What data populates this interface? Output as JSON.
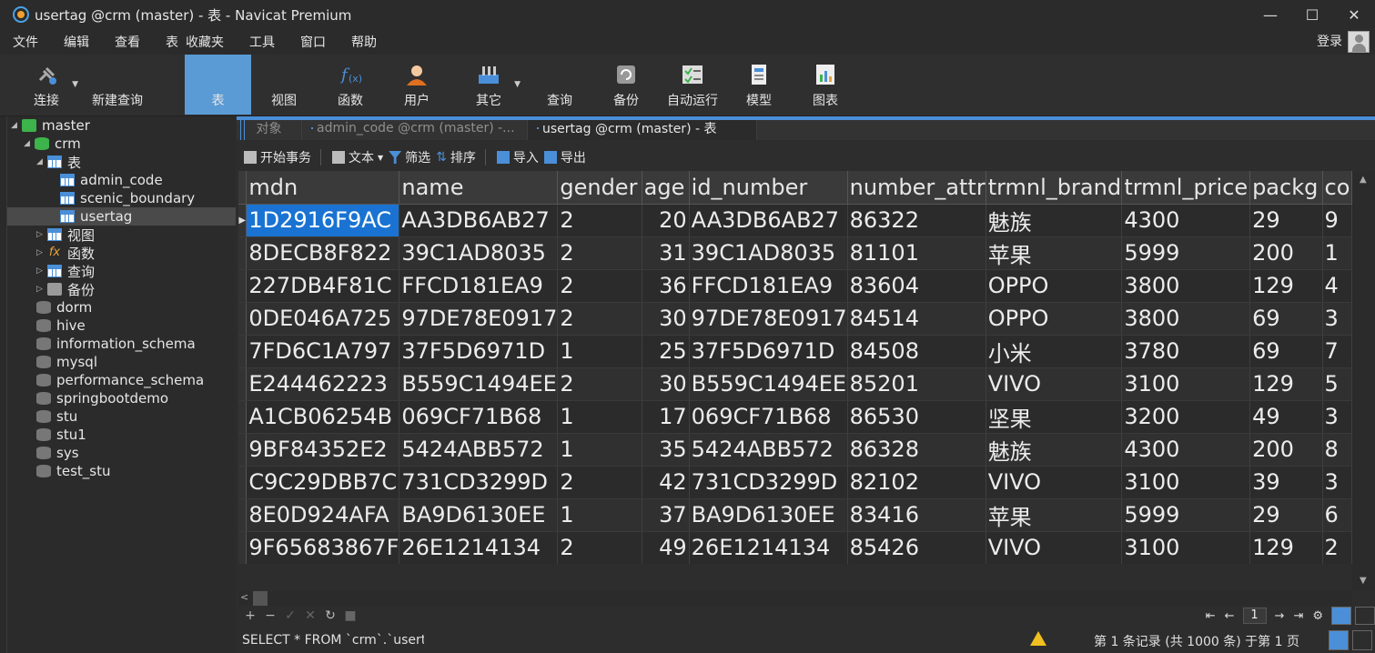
{
  "window": {
    "title": "usertag @crm (master) - 表 - Navicat Premium",
    "controls": [
      "—",
      "☐",
      "✕"
    ]
  },
  "menu": {
    "items": [
      "文件",
      "编辑",
      "查看",
      "表",
      "收藏夹",
      "工具",
      "窗口",
      "帮助"
    ],
    "login": "登录"
  },
  "toolbar": {
    "connect": "连接",
    "new_query": "新建查询",
    "table": "表",
    "view": "视图",
    "function": "函数",
    "user": "用户",
    "other": "其它",
    "query": "查询",
    "backup": "备份",
    "auto_run": "自动运行",
    "model": "模型",
    "chart": "图表"
  },
  "tree": {
    "connection": "master",
    "database": "crm",
    "tables_folder": "表",
    "tables": [
      "admin_code",
      "scenic_boundary",
      "usertag"
    ],
    "views": "视图",
    "functions": "函数",
    "queries": "查询",
    "backups": "备份",
    "other_dbs": [
      "dorm",
      "hive",
      "information_schema",
      "mysql",
      "performance_schema",
      "springbootdemo",
      "stu",
      "stu1",
      "sys",
      "test_stu"
    ]
  },
  "tabs": [
    {
      "label": "对象"
    },
    {
      "label": "admin_code @crm (master) -..."
    },
    {
      "label": "usertag @crm (master) - 表"
    }
  ],
  "subtoolbar": {
    "begin_transaction": "开始事务",
    "text": "文本",
    "filter": "筛选",
    "sort": "排序",
    "import": "导入",
    "export": "导出"
  },
  "grid": {
    "columns": [
      "mdn",
      "name",
      "gender",
      "age",
      "id_number",
      "number_attr",
      "trmnl_brand",
      "trmnl_price",
      "packg",
      "co"
    ],
    "rows": [
      [
        "1D2916F9AC",
        "AA3DB6AB27",
        "2",
        "20",
        "AA3DB6AB27",
        "86322",
        "魅族",
        "4300",
        "29",
        "9"
      ],
      [
        "8DECB8F822",
        "39C1AD8035",
        "2",
        "31",
        "39C1AD8035",
        "81101",
        "苹果",
        "5999",
        "200",
        "1"
      ],
      [
        "227DB4F81C",
        "FFCD181EA9",
        "2",
        "36",
        "FFCD181EA9",
        "83604",
        "OPPO",
        "3800",
        "129",
        "4"
      ],
      [
        "0DE046A725",
        "97DE78E0917",
        "2",
        "30",
        "97DE78E0917",
        "84514",
        "OPPO",
        "3800",
        "69",
        "3"
      ],
      [
        "7FD6C1A797",
        "37F5D6971D",
        "1",
        "25",
        "37F5D6971D",
        "84508",
        "小米",
        "3780",
        "69",
        "7"
      ],
      [
        "E244462223",
        "B559C1494EE",
        "2",
        "30",
        "B559C1494EE",
        "85201",
        "VIVO",
        "3100",
        "129",
        "5"
      ],
      [
        "A1CB06254B",
        "069CF71B68",
        "1",
        "17",
        "069CF71B68",
        "86530",
        "坚果",
        "3200",
        "49",
        "3"
      ],
      [
        "9BF84352E2",
        "5424ABB572",
        "1",
        "35",
        "5424ABB572",
        "86328",
        "魅族",
        "4300",
        "200",
        "8"
      ],
      [
        "C9C29DBB7C",
        "731CD3299D",
        "2",
        "42",
        "731CD3299D",
        "82102",
        "VIVO",
        "3100",
        "39",
        "3"
      ],
      [
        "8E0D924AFA",
        "BA9D6130EE",
        "1",
        "37",
        "BA9D6130EE",
        "83416",
        "苹果",
        "5999",
        "29",
        "6"
      ],
      [
        "9F65683867F",
        "26E1214134",
        "2",
        "49",
        "26E1214134",
        "85426",
        "VIVO",
        "3100",
        "129",
        "2"
      ]
    ]
  },
  "pager": {
    "page": "1"
  },
  "status": {
    "sql": "SELECT * FROM `crm`.`usert",
    "records": "第 1 条记录 (共 1000 条) 于第 1 页"
  }
}
